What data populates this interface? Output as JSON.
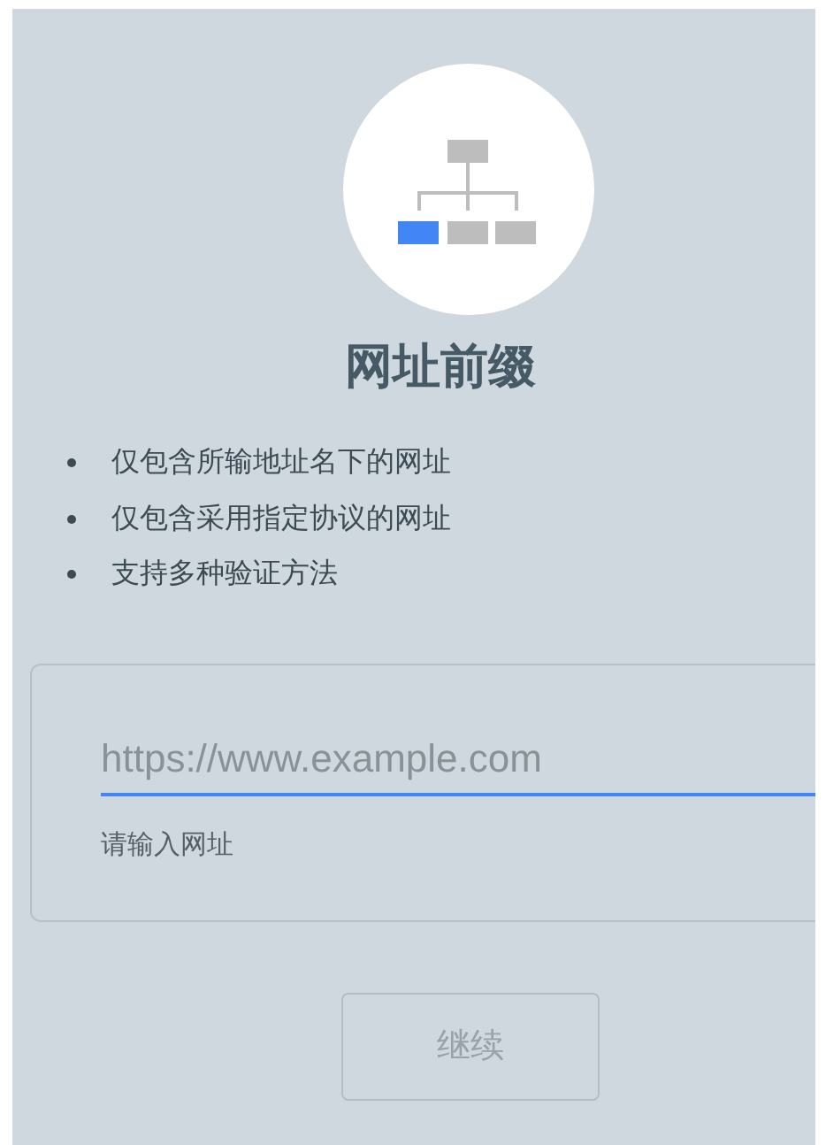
{
  "title": "网址前缀",
  "features": [
    "仅包含所输地址名下的网址",
    "仅包含采用指定协议的网址",
    "支持多种验证方法"
  ],
  "url_field": {
    "placeholder": "https://www.example.com",
    "helper": "请输入网址",
    "focused": true
  },
  "continue_button": {
    "label": "继续",
    "disabled": true
  }
}
